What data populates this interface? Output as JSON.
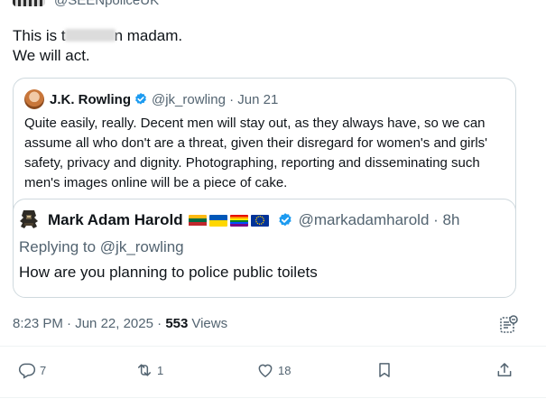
{
  "header": {
    "handle": "@SEENpoliceUK",
    "avatar_icon": "police-checker-icon"
  },
  "tweet": {
    "line1_start": "This is t",
    "line1_end": "n madam.",
    "line2": "We will act."
  },
  "quote": {
    "author_name": "J.K. Rowling",
    "author_handle": "@jk_rowling",
    "separator": "·",
    "date": "Jun 21",
    "body": "Quite easily, really. Decent men will stay out, as they always have, so we can assume all who don't are a threat, given their disregard for women's and girls' safety, privacy and dignity. Photographing, reporting and disseminating such men's images online will be a piece of cake.",
    "inner": {
      "author_name": "Mark Adam Harold",
      "author_handle": "@markadamharold",
      "separator": "·",
      "time": "8h",
      "reply_prefix": "Replying to ",
      "reply_to": "@jk_rowling",
      "text": "How are you planning to police public toilets"
    }
  },
  "meta": {
    "time": "8:23 PM",
    "sep1": "·",
    "date": "Jun 22, 2025",
    "sep2": "·",
    "views_count": "553",
    "views_label": "Views"
  },
  "actions": {
    "reply_count": "7",
    "repost_count": "1",
    "like_count": "18"
  },
  "colors": {
    "verified": "#1d9bf0",
    "secondary_text": "#536471",
    "border": "#cfd9de"
  }
}
